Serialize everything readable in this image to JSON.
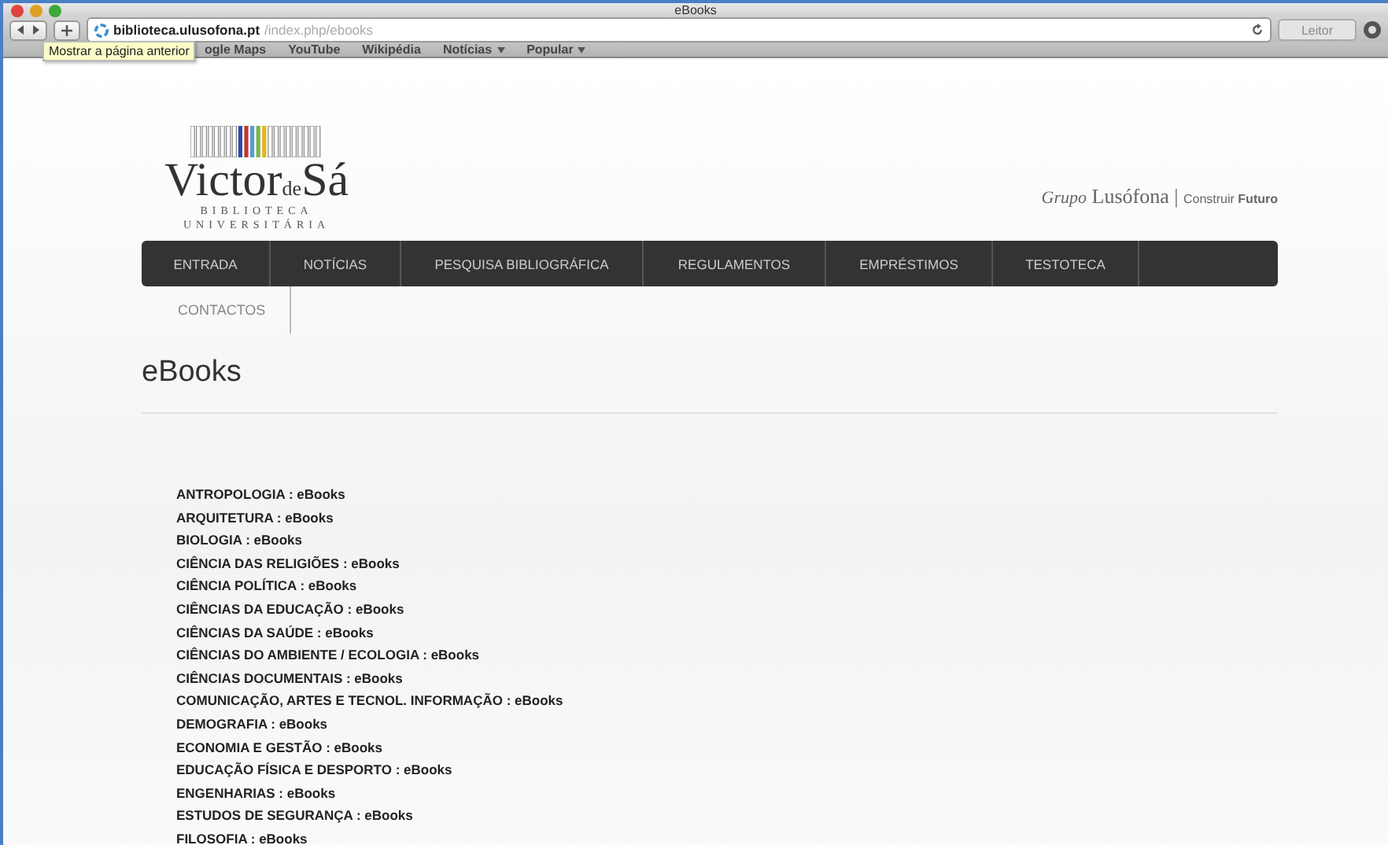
{
  "window": {
    "title": "eBooks"
  },
  "toolbar": {
    "address_host": "biblioteca.ulusofona.pt",
    "address_path": "/index.php/ebooks",
    "reader_button": {
      "label": "Leitor",
      "disabled": true
    }
  },
  "bookmarks": [
    {
      "label": "ogle Maps",
      "menu": false
    },
    {
      "label": "YouTube",
      "menu": false
    },
    {
      "label": "Wikipédia",
      "menu": false
    },
    {
      "label": "Notícias",
      "menu": true
    },
    {
      "label": "Popular",
      "menu": true
    }
  ],
  "tooltip": "Mostrar a página anterior",
  "header": {
    "logo_name": "Victor",
    "logo_small": "de",
    "logo_end": "Sá",
    "logo_line1": "BIBLIOTECA",
    "logo_line2": "UNIVERSITÁRIA",
    "group_prefix": "Grupo",
    "group_name": "Lusófona",
    "group_sep": "|",
    "motto_a": "Construir",
    "motto_b": "Futuro"
  },
  "nav": [
    {
      "label": "ENTRADA"
    },
    {
      "label": "NOTÍCIAS"
    },
    {
      "label": "PESQUISA BIBLIOGRÁFICA"
    },
    {
      "label": "REGULAMENTOS"
    },
    {
      "label": "EMPRÉSTIMOS"
    },
    {
      "label": "TESTOTECA"
    }
  ],
  "nav_second_row": [
    {
      "label": "CONTACTOS"
    }
  ],
  "page_title": "eBooks",
  "links": [
    "ANTROPOLOGIA : eBooks",
    "ARQUITETURA : eBooks",
    "BIOLOGIA : eBooks",
    "CIÊNCIA DAS RELIGIÕES : eBooks",
    "CIÊNCIA POLÍTICA : eBooks",
    "CIÊNCIAS DA EDUCAÇÃO : eBooks",
    "CIÊNCIAS DA SAÚDE : eBooks",
    "CIÊNCIAS DO AMBIENTE / ECOLOGIA : eBooks",
    "CIÊNCIAS DOCUMENTAIS : eBooks",
    "COMUNICAÇÃO, ARTES E TECNOL. INFORMAÇÃO : eBooks",
    "DEMOGRAFIA : eBooks",
    "ECONOMIA E GESTÃO : eBooks",
    "EDUCAÇÃO FÍSICA E DESPORTO : eBooks",
    "ENGENHARIAS : eBooks",
    "ESTUDOS DE SEGURANÇA : eBooks",
    "FILOSOFIA : eBooks"
  ]
}
